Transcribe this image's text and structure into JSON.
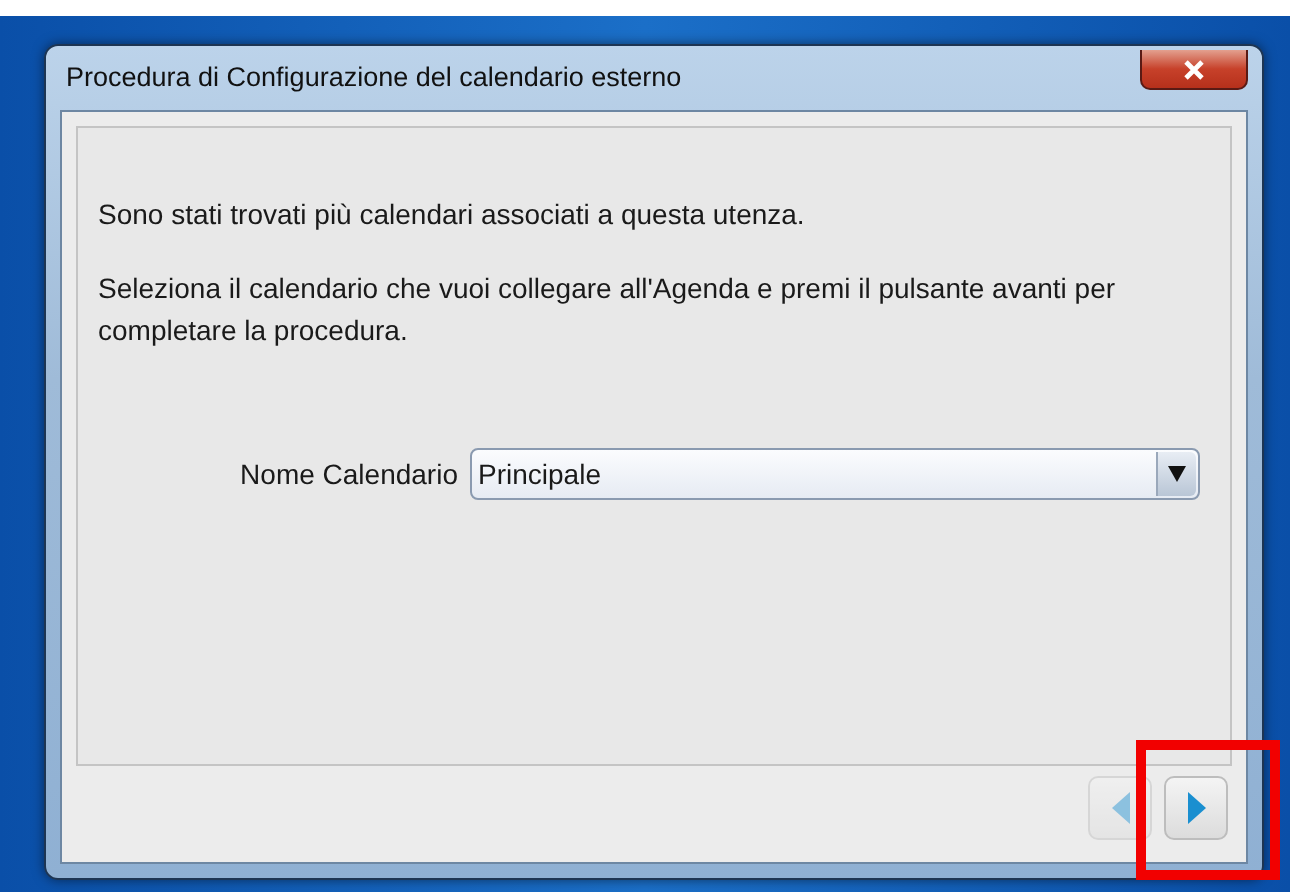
{
  "window": {
    "title": "Procedura di Configurazione del calendario esterno"
  },
  "messages": [
    "Sono stati trovati più calendari associati a questa utenza.",
    "Seleziona il calendario che vuoi collegare all'Agenda e premi il pulsante avanti per completare la procedura."
  ],
  "calendar_field": {
    "label": "Nome Calendario",
    "value": "Principale"
  },
  "nav_buttons": [
    {
      "kind": "back",
      "disabled": true
    },
    {
      "kind": "next",
      "disabled": false
    }
  ]
}
